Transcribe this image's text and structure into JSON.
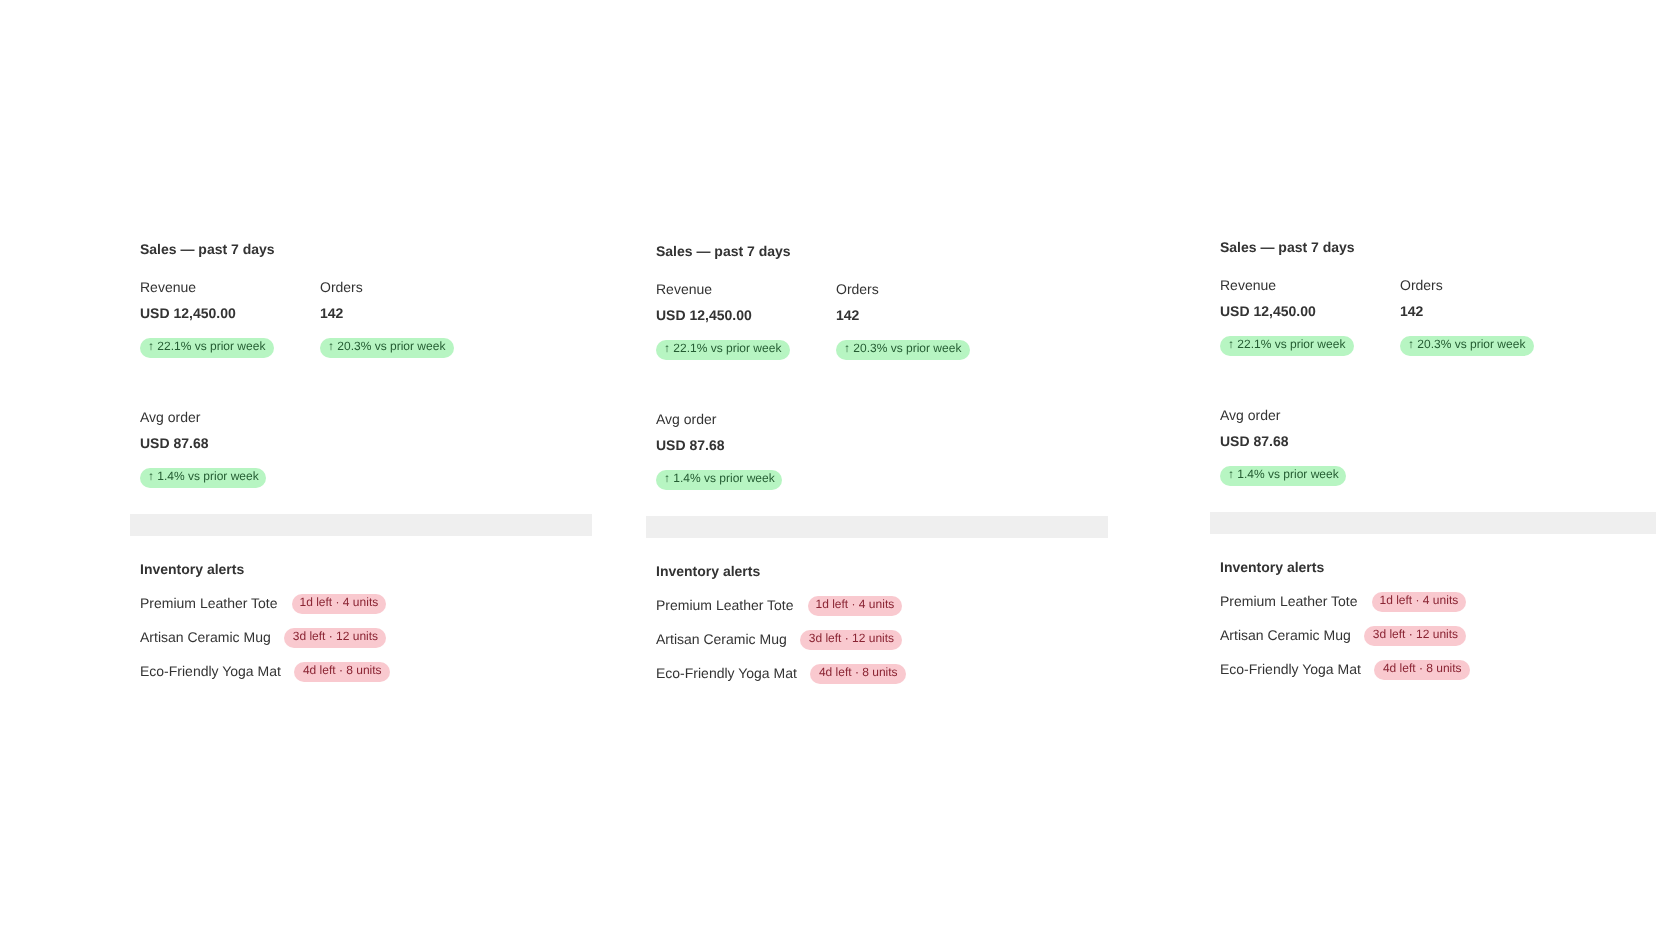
{
  "panels": [
    {
      "title": "Sales — past 7 days",
      "metrics": [
        {
          "label": "Revenue",
          "value": "USD 12,450.00",
          "change": "↑ 22.1% vs prior week"
        },
        {
          "label": "Orders",
          "value": "142",
          "change": "↑ 20.3% vs prior week"
        },
        {
          "label": "Avg order",
          "value": "USD 87.68",
          "change": "↑ 1.4% vs prior week"
        }
      ],
      "alerts_title": "Inventory alerts",
      "alerts": [
        {
          "name": "Premium Leather Tote",
          "badge": "1d left · 4 units"
        },
        {
          "name": "Artisan Ceramic Mug",
          "badge": "3d left · 12 units"
        },
        {
          "name": "Eco-Friendly Yoga Mat",
          "badge": "4d left · 8 units"
        }
      ]
    },
    {
      "title": "Sales — past 7 days",
      "metrics": [
        {
          "label": "Revenue",
          "value": "USD 12,450.00",
          "change": "↑ 22.1% vs prior week"
        },
        {
          "label": "Orders",
          "value": "142",
          "change": "↑ 20.3% vs prior week"
        },
        {
          "label": "Avg order",
          "value": "USD 87.68",
          "change": "↑ 1.4% vs prior week"
        }
      ],
      "alerts_title": "Inventory alerts",
      "alerts": [
        {
          "name": "Premium Leather Tote",
          "badge": "1d left · 4 units"
        },
        {
          "name": "Artisan Ceramic Mug",
          "badge": "3d left · 12 units"
        },
        {
          "name": "Eco-Friendly Yoga Mat",
          "badge": "4d left · 8 units"
        }
      ]
    },
    {
      "title": "Sales — past 7 days",
      "metrics": [
        {
          "label": "Revenue",
          "value": "USD 12,450.00",
          "change": "↑ 22.1% vs prior week"
        },
        {
          "label": "Orders",
          "value": "142",
          "change": "↑ 20.3% vs prior week"
        },
        {
          "label": "Avg order",
          "value": "USD 87.68",
          "change": "↑ 1.4% vs prior week"
        }
      ],
      "alerts_title": "Inventory alerts",
      "alerts": [
        {
          "name": "Premium Leather Tote",
          "badge": "1d left · 4 units"
        },
        {
          "name": "Artisan Ceramic Mug",
          "badge": "3d left · 12 units"
        },
        {
          "name": "Eco-Friendly Yoga Mat",
          "badge": "4d left · 8 units"
        }
      ]
    }
  ]
}
